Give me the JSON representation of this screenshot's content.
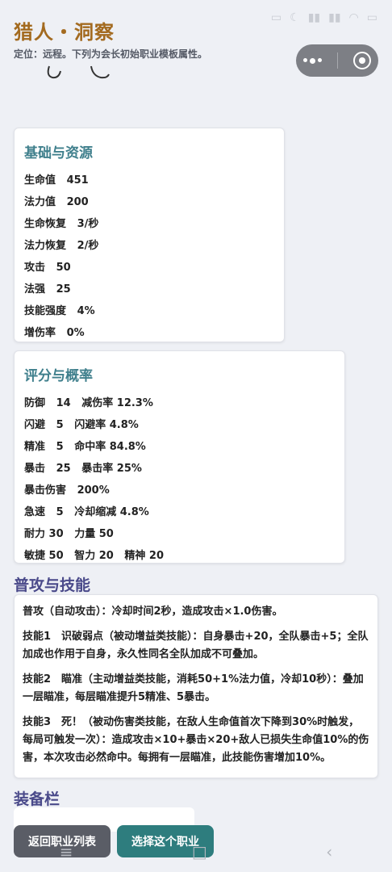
{
  "status": {
    "icons": [
      "battery-icon",
      "alarm-icon",
      "signal-icon",
      "signal-icon",
      "wifi-icon",
      "battery-full-icon"
    ]
  },
  "header": {
    "title": "猎人・洞察",
    "subtitle": "定位：远程。下列为会长初始职业模板属性。"
  },
  "basic": {
    "title": "基础与资源",
    "rows": [
      "生命值   451",
      "法力值   200",
      "生命恢复   3/秒",
      "法力恢复   2/秒",
      "攻击   50",
      "法强   25",
      "技能强度   4%",
      "增伤率   0%"
    ]
  },
  "ratings": {
    "title": "评分与概率",
    "rows": [
      "防御   14   减伤率 12.3%",
      "闪避   5   闪避率 4.8%",
      "精准   5   命中率 84.8%",
      "暴击   25   暴击率 25%",
      "暴击伤害   200%",
      "急速   5   冷却缩减 4.8%",
      "耐力 30   力量 50",
      "敏捷 50   智力 20   精神 20"
    ]
  },
  "skills": {
    "title": "普攻与技能",
    "items": [
      "普攻（自动攻击）：冷却时间2秒，造成攻击×1.0伤害。",
      "技能1　识破弱点（被动增益类技能）：自身暴击+20，全队暴击+5；全队加成也作用于自身，永久性同名全队加成不可叠加。",
      "技能2　瞄准（主动增益类技能，消耗50+1%法力值，冷却10秒）：叠加一层瞄准，每层瞄准提升5精准、5暴击。",
      "技能3　死！（被动伤害类技能，在敌人生命值首次下降到30%时触发，每局可触发一次）：造成攻击×10+暴击×20+敌人已损失生命值10%的伤害，本次攻击必然命中。每拥有一层瞄准，此技能伤害增加10%。"
    ]
  },
  "equipment": {
    "title": "装备栏"
  },
  "buttons": {
    "back": "返回职业列表",
    "choose": "选择这个职业"
  }
}
